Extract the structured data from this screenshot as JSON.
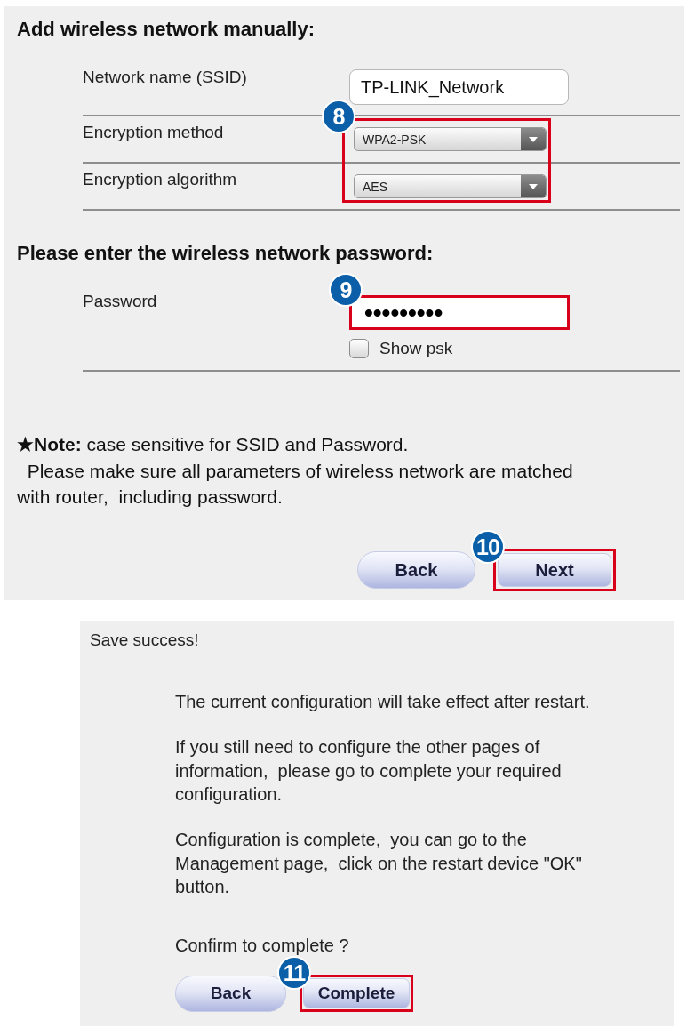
{
  "wifi_form": {
    "title": "Add wireless network manually:",
    "rows": [
      {
        "kind": "text",
        "label": "Network name (SSID)",
        "value": "TP-LINK_Network"
      },
      {
        "kind": "highlight",
        "step": "8",
        "rows": [
          {
            "kind": "select",
            "label": "Encryption method",
            "value": "WPA2-PSK"
          },
          {
            "kind": "select",
            "label": "Encryption algorithm",
            "value": "AES"
          }
        ]
      }
    ],
    "password_title": "Please enter the wireless network password:",
    "password": {
      "label": "Password",
      "value": "•••••••••",
      "highlighted": true,
      "step": "9"
    },
    "show_psk": {
      "label": "Show psk",
      "checked": false
    },
    "note": {
      "lead": "**★Note:** case sensitive for SSID and Password.",
      "text": "  Please make sure all parameters of wireless network are matched with router,  including password."
    },
    "buttons": [
      {
        "label": "Back",
        "highlighted": false
      },
      {
        "label": "Next",
        "highlighted": true,
        "step": "10"
      }
    ]
  },
  "save_dialog": {
    "title": "Save success!",
    "paragraphs": [
      "The current configuration will take effect after restart.",
      "If you still need to configure the other pages of information,  please go to complete your required configuration.",
      "Configuration is complete,  you can go to the Management page,  click on the restart device \"OK\" button."
    ],
    "question": "Confirm to complete ?",
    "buttons": [
      {
        "label": "Back",
        "highlighted": false
      },
      {
        "label": "Complete",
        "highlighted": true,
        "step": "11"
      }
    ]
  }
}
